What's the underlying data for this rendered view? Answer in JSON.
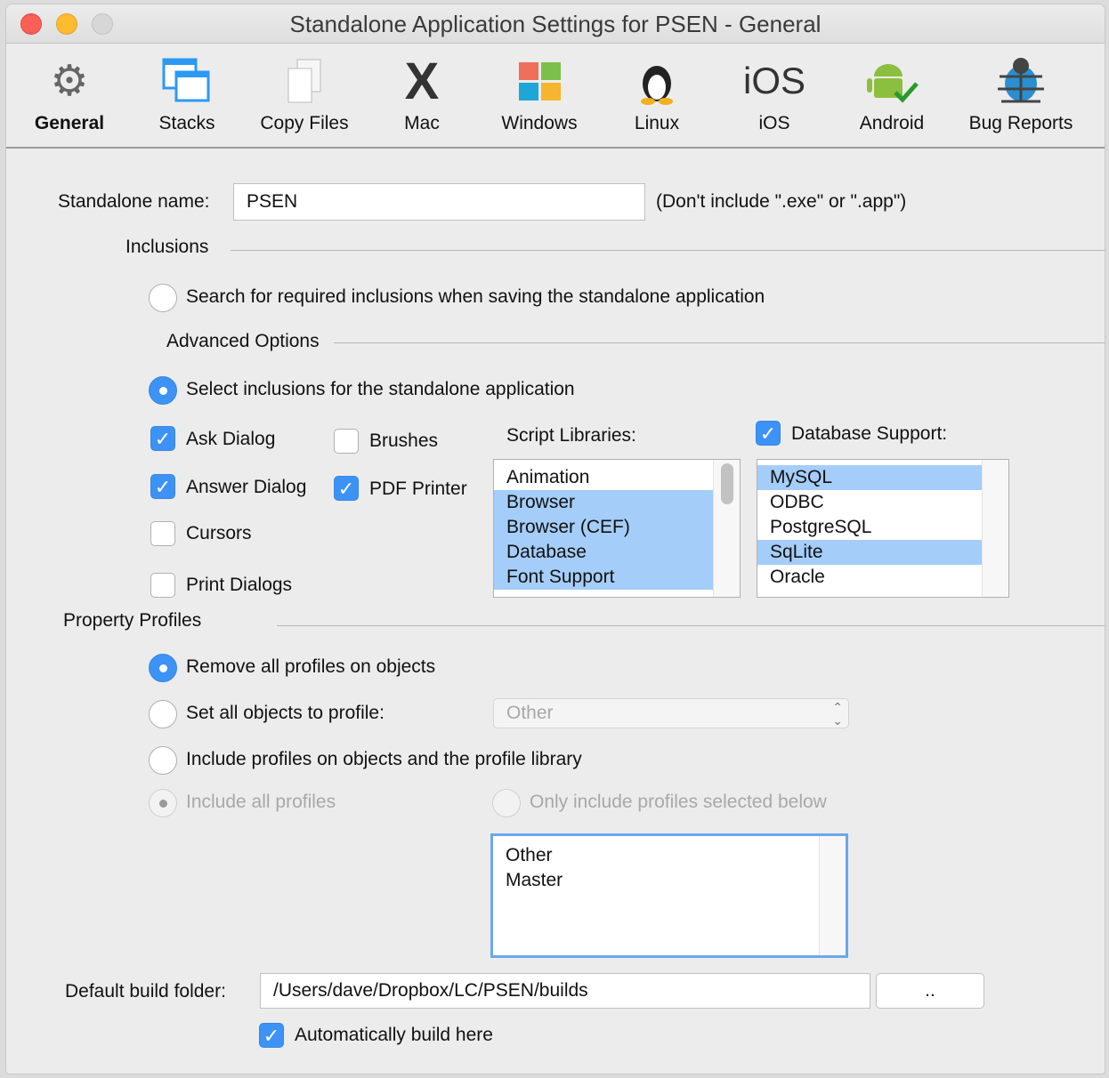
{
  "window": {
    "title": "Standalone Application Settings for PSEN - General"
  },
  "toolbar": [
    {
      "label": "General",
      "icon": "gear-icon"
    },
    {
      "label": "Stacks",
      "icon": "stacks-icon"
    },
    {
      "label": "Copy Files",
      "icon": "copy-files-icon"
    },
    {
      "label": "Mac",
      "icon": "mac-x-icon"
    },
    {
      "label": "Windows",
      "icon": "windows-icon"
    },
    {
      "label": "Linux",
      "icon": "linux-icon"
    },
    {
      "label": "iOS",
      "icon": "ios-icon",
      "glyph": "iOS"
    },
    {
      "label": "Android",
      "icon": "android-icon"
    },
    {
      "label": "Bug Reports",
      "icon": "bug-icon"
    }
  ],
  "general": {
    "name_label": "Standalone name:",
    "name_value": "PSEN",
    "name_hint": "(Don't include \".exe\" or \".app\")",
    "inclusions_label": "Inclusions",
    "search_radio": "Search for required inclusions when saving the standalone application",
    "advanced_label": "Advanced Options",
    "select_radio": "Select inclusions for the standalone application",
    "checks": [
      {
        "label": "Ask Dialog",
        "checked": true
      },
      {
        "label": "Brushes",
        "checked": false
      },
      {
        "label": "Answer Dialog",
        "checked": true
      },
      {
        "label": "PDF Printer",
        "checked": true
      },
      {
        "label": "Cursors",
        "checked": false
      },
      {
        "label": "Print Dialogs",
        "checked": false
      }
    ],
    "script_libraries_label": "Script Libraries:",
    "script_libraries": [
      {
        "label": "Animation",
        "selected": false
      },
      {
        "label": "Browser",
        "selected": true
      },
      {
        "label": "Browser (CEF)",
        "selected": true
      },
      {
        "label": "Database",
        "selected": true
      },
      {
        "label": "Font Support",
        "selected": true
      }
    ],
    "database_label": "Database Support:",
    "database_checked": true,
    "databases": [
      {
        "label": "MySQL",
        "selected": true
      },
      {
        "label": "ODBC",
        "selected": false
      },
      {
        "label": "PostgreSQL",
        "selected": false
      },
      {
        "label": "SqLite",
        "selected": true
      },
      {
        "label": "Oracle",
        "selected": false
      }
    ],
    "profiles_label": "Property Profiles",
    "remove_radio": "Remove all profiles on objects",
    "set_radio": "Set all objects to profile:",
    "profile_select": "Other",
    "include_radio": "Include profiles on objects and the profile library",
    "include_all": "Include all profiles",
    "only_include": "Only include profiles selected below",
    "profile_list": [
      "Other",
      "Master"
    ],
    "build_label": "Default build folder:",
    "build_value": "/Users/dave/Dropbox/LC/PSEN/builds",
    "browse_label": "..",
    "auto_build": "Automatically build here"
  }
}
